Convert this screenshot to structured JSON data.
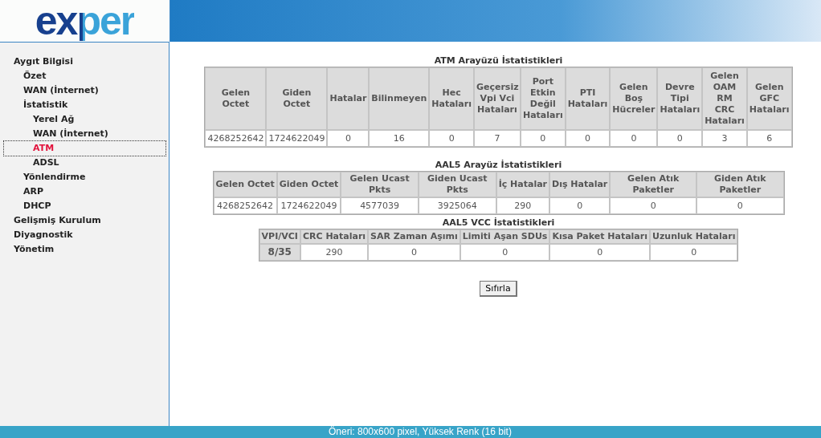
{
  "logo": "exper",
  "sidebar": {
    "items": [
      {
        "label": "Aygıt Bilgisi",
        "selected": false,
        "children": [
          {
            "label": "Özet",
            "selected": false
          },
          {
            "label": "WAN (İnternet)",
            "selected": false
          },
          {
            "label": "İstatistik",
            "selected": false,
            "children": [
              {
                "label": "Yerel Ağ",
                "selected": false
              },
              {
                "label": "WAN (İnternet)",
                "selected": false
              },
              {
                "label": "ATM",
                "selected": true
              },
              {
                "label": "ADSL",
                "selected": false
              }
            ]
          },
          {
            "label": "Yönlendirme",
            "selected": false
          },
          {
            "label": "ARP",
            "selected": false
          },
          {
            "label": "DHCP",
            "selected": false
          }
        ]
      },
      {
        "label": "Gelişmiş Kurulum",
        "selected": false
      },
      {
        "label": "Diyagnostik",
        "selected": false
      },
      {
        "label": "Yönetim",
        "selected": false
      }
    ]
  },
  "tables": [
    {
      "title": "ATM Arayüzü İstatistikleri",
      "row_header": false,
      "columns": [
        "Gelen Octet",
        "Giden Octet",
        "Hatalar",
        "Bilinmeyen",
        "Hec Hataları",
        "Geçersiz Vpi Vci Hataları",
        "Port Etkin Değil Hataları",
        "PTI Hataları",
        "Gelen Boş Hücreler",
        "Devre Tipi Hataları",
        "Gelen OAM RM CRC Hataları",
        "Gelen GFC Hataları"
      ],
      "rows": [
        [
          "4268252642",
          "1724622049",
          "0",
          "16",
          "0",
          "7",
          "0",
          "0",
          "0",
          "0",
          "3",
          "6"
        ]
      ]
    },
    {
      "title": "AAL5 Arayüz İstatistikleri",
      "row_header": false,
      "columns": [
        "Gelen Octet",
        "Giden Octet",
        "Gelen Ucast Pkts",
        "Giden Ucast Pkts",
        "İç Hatalar",
        "Dış Hatalar",
        "Gelen Atık Paketler",
        "Giden Atık Paketler"
      ],
      "rows": [
        [
          "4268252642",
          "1724622049",
          "4577039",
          "3925064",
          "290",
          "0",
          "0",
          "0"
        ]
      ]
    },
    {
      "title": "AAL5 VCC İstatistikleri",
      "row_header": true,
      "columns": [
        "VPI/VCI",
        "CRC Hataları",
        "SAR Zaman Aşımı",
        "Limiti Aşan SDUs",
        "Kısa Paket Hataları",
        "Uzunluk Hataları"
      ],
      "rows": [
        [
          "8/35",
          "290",
          "0",
          "0",
          "0",
          "0"
        ]
      ]
    }
  ],
  "reset_button": "Sıfırla",
  "status_bar": "Öneri: 800x600 pixel, Yüksek Renk (16 bit)"
}
